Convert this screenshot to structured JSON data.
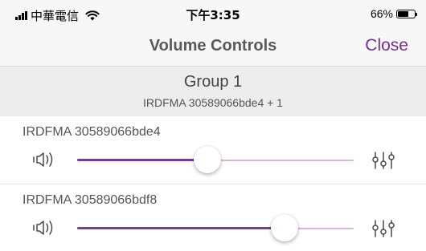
{
  "status_bar": {
    "carrier": "中華電信",
    "time": "下午3:35",
    "battery_percent": "66%",
    "battery_level": 0.66,
    "icons": [
      "signal-icon",
      "wifi-icon",
      "battery-icon"
    ]
  },
  "nav": {
    "title": "Volume Controls",
    "close_label": "Close"
  },
  "group": {
    "title": "Group 1",
    "subtitle": "IRDFMA 30589066bde4 + 1"
  },
  "devices": [
    {
      "name": "IRDFMA 30589066bde4",
      "volume": 0.47,
      "icons": [
        "speaker-icon",
        "equalizer-icon"
      ]
    },
    {
      "name": "IRDFMA 30589066bdf8",
      "volume": 0.75,
      "icons": [
        "speaker-icon",
        "equalizer-icon"
      ]
    }
  ],
  "colors": {
    "accent": "#7b2d8e",
    "slider_fill": "#7b3a96",
    "slider_track": "#d9b6e0",
    "nav_background": "#f7f7f7",
    "group_background": "#ededed"
  }
}
